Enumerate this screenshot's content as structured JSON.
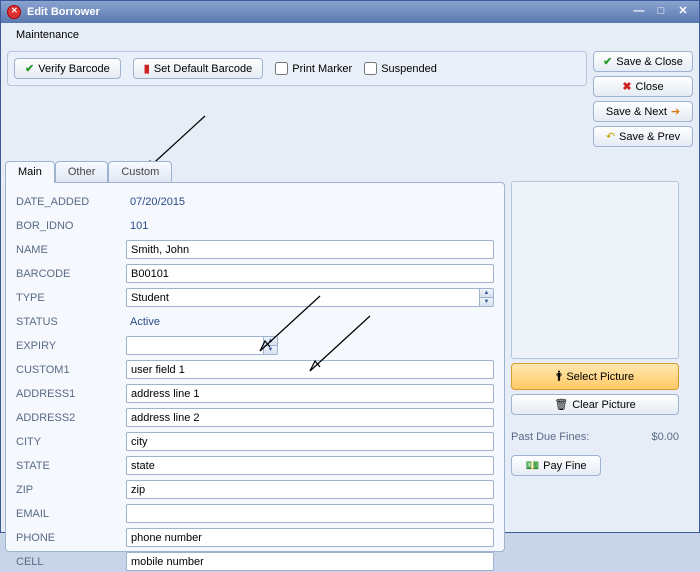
{
  "window": {
    "title": "Edit Borrower"
  },
  "menu": {
    "maintenance": "Maintenance"
  },
  "toolbar": {
    "verify_barcode": "Verify Barcode",
    "set_default_barcode": "Set Default Barcode",
    "print_marker": "Print Marker",
    "suspended": "Suspended"
  },
  "buttons": {
    "save_close": "Save & Close",
    "close": "Close",
    "save_next": "Save & Next",
    "save_prev": "Save & Prev"
  },
  "tabs": {
    "main": "Main",
    "other": "Other",
    "custom": "Custom"
  },
  "labels": {
    "date_added": "DATE_ADDED",
    "bor_idno": "BOR_IDNO",
    "name": "NAME",
    "barcode": "BARCODE",
    "type": "TYPE",
    "status": "STATUS",
    "expiry": "EXPIRY",
    "custom1": "CUSTOM1",
    "address1": "ADDRESS1",
    "address2": "ADDRESS2",
    "city": "CITY",
    "state": "STATE",
    "zip": "ZIP",
    "email": "EMAIL",
    "phone": "PHONE",
    "cell": "CELL"
  },
  "values": {
    "date_added": "07/20/2015",
    "bor_idno": "101",
    "name": "Smith, John",
    "barcode": "B00101",
    "type": "Student",
    "status": "Active",
    "expiry": "",
    "custom1": "user field 1",
    "address1": "address line 1",
    "address2": "address line 2",
    "city": "city",
    "state": "state",
    "zip": "zip",
    "email": "",
    "phone": "phone number",
    "cell": "mobile number"
  },
  "side": {
    "select_picture": "Select Picture",
    "clear_picture": "Clear Picture",
    "past_due_fines_label": "Past Due Fines:",
    "past_due_fines_value": "$0.00",
    "pay_fine": "Pay Fine"
  }
}
